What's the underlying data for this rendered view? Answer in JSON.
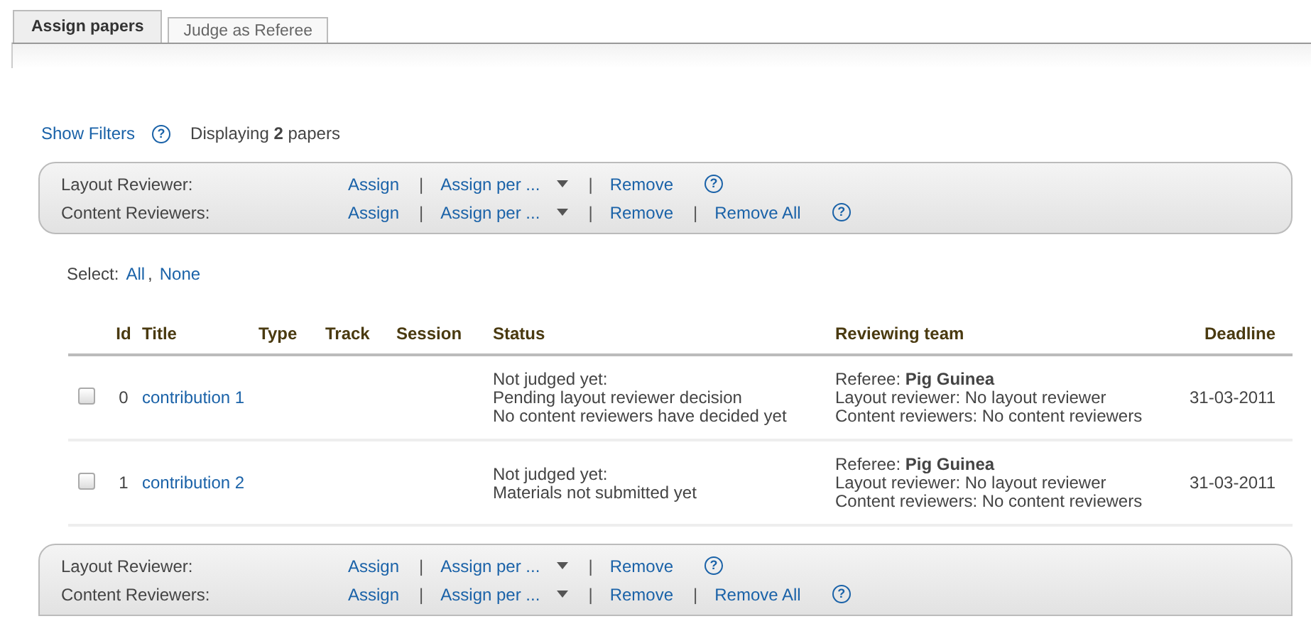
{
  "tabs": [
    {
      "label": "Assign papers",
      "selected": true
    },
    {
      "label": "Judge as Referee",
      "selected": false
    }
  ],
  "filters": {
    "link": "Show Filters",
    "help": "?",
    "summary": "Displaying **2** papers"
  },
  "action_bars": [
    {
      "rows": [
        {
          "label": "Layout Reviewer:",
          "separator": "|",
          "actions": [
            {
              "kind": "link",
              "text": "Assign"
            },
            {
              "kind": "dropdown",
              "text": "Assign per ..."
            },
            {
              "kind": "link",
              "text": "Remove"
            }
          ],
          "help": "?"
        },
        {
          "label": "Content Reviewers:",
          "separator": "|",
          "actions": [
            {
              "kind": "link",
              "text": "Assign"
            },
            {
              "kind": "dropdown",
              "text": "Assign per ..."
            },
            {
              "kind": "link",
              "text": "Remove"
            },
            {
              "kind": "link",
              "text": "Remove All"
            }
          ],
          "help": "?"
        }
      ]
    },
    {
      "rows": [
        {
          "label": "Layout Reviewer:",
          "separator": "|",
          "actions": [
            {
              "kind": "link",
              "text": "Assign"
            },
            {
              "kind": "dropdown",
              "text": "Assign per ..."
            },
            {
              "kind": "link",
              "text": "Remove"
            }
          ],
          "help": "?"
        },
        {
          "label": "Content Reviewers:",
          "separator": "|",
          "actions": [
            {
              "kind": "link",
              "text": "Assign"
            },
            {
              "kind": "dropdown",
              "text": "Assign per ..."
            },
            {
              "kind": "link",
              "text": "Remove"
            },
            {
              "kind": "link",
              "text": "Remove All"
            }
          ],
          "help": "?"
        }
      ]
    }
  ],
  "select": {
    "label": "Select:",
    "all": "All",
    "separator": ",",
    "none": "None"
  },
  "table": {
    "columns": [
      "Id",
      "Title",
      "Type",
      "Track",
      "Session",
      "Status",
      "Reviewing team",
      "Deadline"
    ],
    "rows": [
      {
        "checked": false,
        "id": "0",
        "title": "contribution 1",
        "status": [
          "Not judged yet:",
          "Pending layout reviewer decision",
          "No content reviewers have decided yet"
        ],
        "team": [
          "Referee: **Pig Guinea**",
          "Layout reviewer: No layout reviewer",
          "Content reviewers: No content reviewers"
        ],
        "deadline": "31-03-2011"
      },
      {
        "checked": false,
        "id": "1",
        "title": "contribution 2",
        "status": [
          "Not judged yet:",
          "Materials not submitted yet"
        ],
        "team": [
          "Referee: **Pig Guinea**",
          "Layout reviewer: No layout reviewer",
          "Content reviewers: No content reviewers"
        ],
        "deadline": "31-03-2011"
      }
    ]
  }
}
